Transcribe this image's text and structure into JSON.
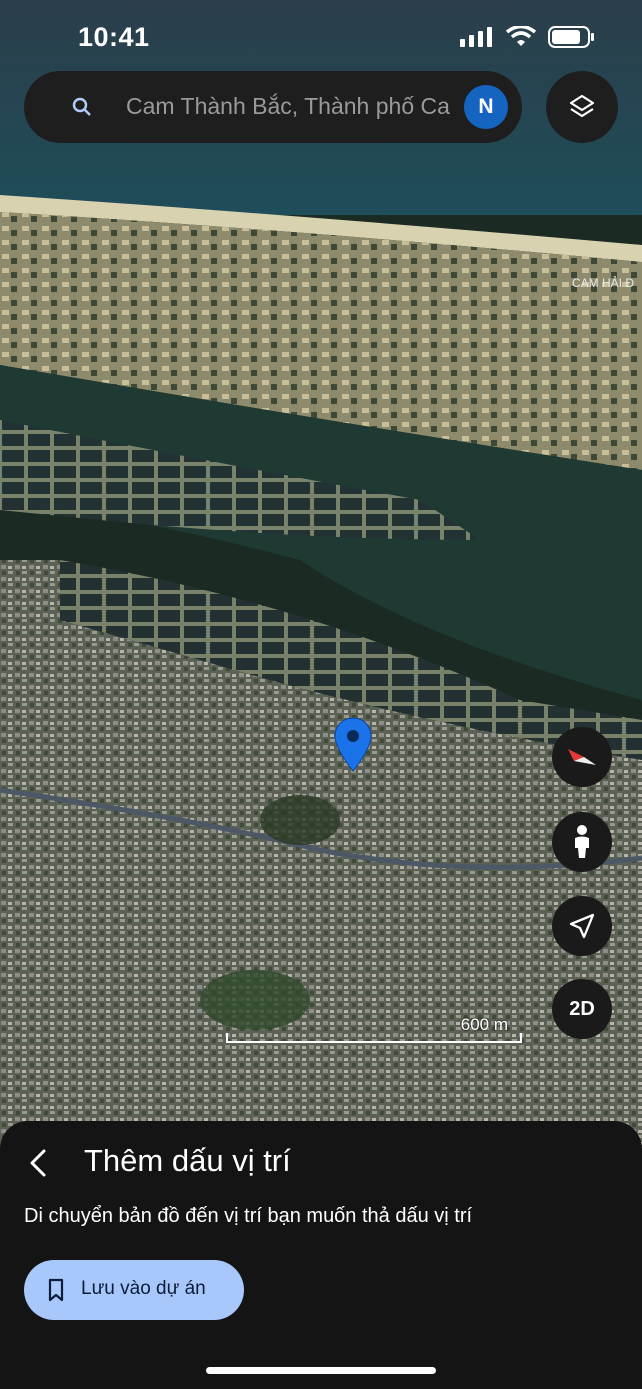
{
  "status_bar": {
    "time": "10:41"
  },
  "search": {
    "query": "Cam Thành Bắc, Thành phố Ca",
    "avatar_letter": "N"
  },
  "map": {
    "place_label": "CAM HẢI Đ",
    "scale_label": "600 m",
    "view_mode_label": "2D"
  },
  "sheet": {
    "title": "Thêm dấu vị trí",
    "description": "Di chuyển bản đồ đến vị trí bạn muốn thả dấu vị trí",
    "save_label": "Lưu vào dự án"
  },
  "colors": {
    "accent": "#a8c7fa",
    "pin": "#1a73e8",
    "avatar": "#1565c0"
  },
  "icons": [
    "search-icon",
    "layers-icon",
    "compass-icon",
    "street-view-icon",
    "location-arrow-icon",
    "back-arrow-icon",
    "bookmark-icon",
    "map-pin-icon"
  ]
}
